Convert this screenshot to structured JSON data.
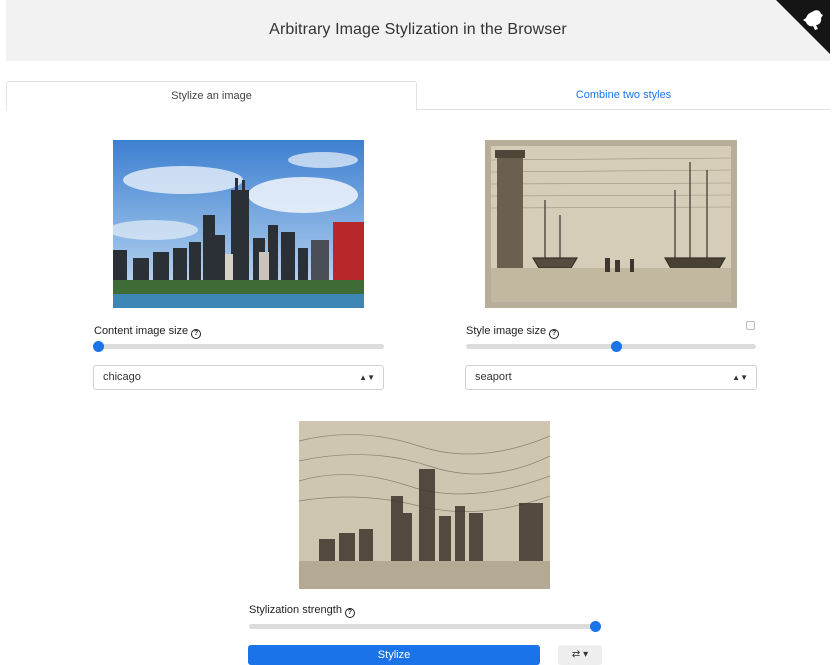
{
  "header": {
    "title": "Arbitrary Image Stylization in the Browser",
    "corner_icon": "github-icon"
  },
  "tabs": [
    {
      "label": "Stylize an image",
      "active": true
    },
    {
      "label": "Combine two styles",
      "active": false
    }
  ],
  "content": {
    "size_label": "Content image size",
    "size_value": 0.0,
    "select_value": "chicago"
  },
  "style": {
    "size_label": "Style image size",
    "size_value": 0.52,
    "select_value": "seaport",
    "checkbox_checked": false
  },
  "result": {
    "strength_label": "Stylization strength",
    "strength_value": 1.0,
    "stylize_label": "Stylize",
    "extra_label": "⇄ ▾"
  },
  "colors": {
    "accent": "#1a73e8",
    "header_bg": "#f2f2f2"
  }
}
